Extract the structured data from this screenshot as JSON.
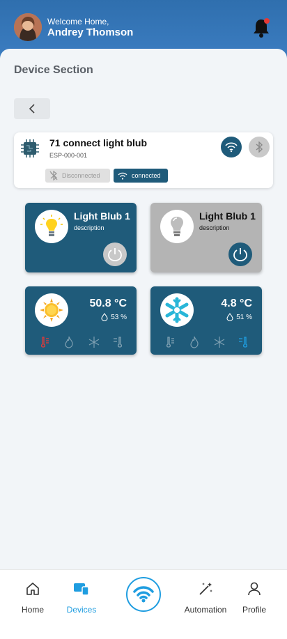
{
  "header": {
    "welcome_text": "Welcome Home,",
    "user_name": "Andrey Thomson",
    "notification_dot": true
  },
  "section": {
    "title": "Device Section"
  },
  "device": {
    "name": "71 connect light blub",
    "id": "ESP-000-001",
    "status_disconnected": "Disconnected",
    "status_connected": "connected"
  },
  "tiles": {
    "light1": {
      "title": "Light Blub 1",
      "description": "description",
      "state": "on"
    },
    "light2": {
      "title": "Light Blub 1",
      "description": "description",
      "state": "off"
    },
    "climate1": {
      "temperature": "50.8 °C",
      "humidity": "53 %",
      "active_mode": "heat"
    },
    "climate2": {
      "temperature": "4.8 °C",
      "humidity": "51 %",
      "active_mode": "cool"
    }
  },
  "nav": {
    "home": "Home",
    "devices": "Devices",
    "automation": "Automation",
    "profile": "Profile",
    "active": "devices"
  },
  "colors": {
    "header_blue": "#2f6fae",
    "card_dark": "#1f5b7a",
    "accent": "#1f9de0",
    "heat_red": "#e03a3a",
    "cool_blue": "#1f9de0"
  }
}
